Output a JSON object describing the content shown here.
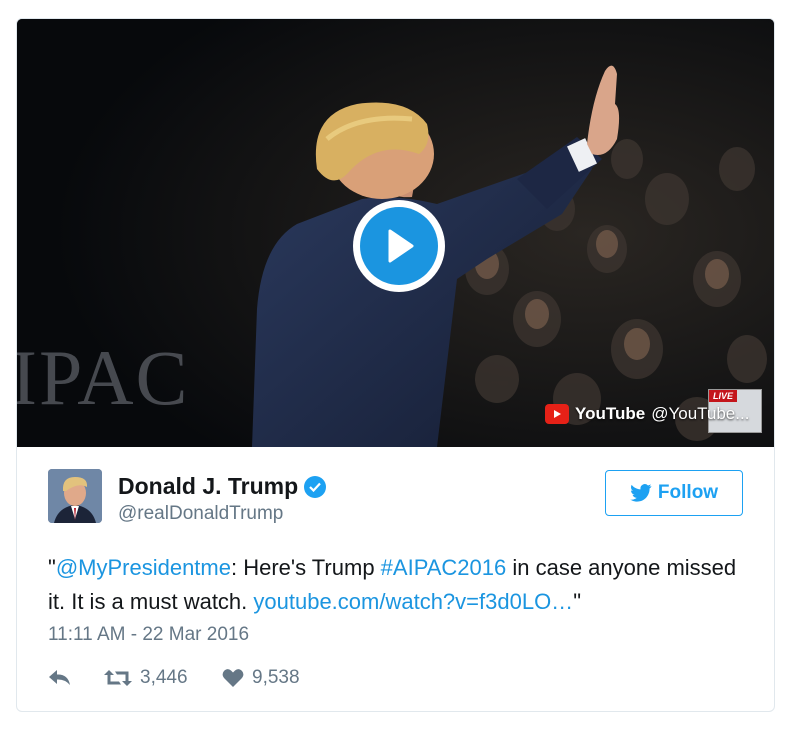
{
  "media": {
    "background_text": "IPAC",
    "youtube": {
      "label": "YouTube",
      "handle": "@YouTube..."
    },
    "live_thumb": {
      "tag": "LIVE"
    }
  },
  "author": {
    "name": "Donald J. Trump",
    "handle": "@realDonaldTrump"
  },
  "follow": {
    "label": "Follow"
  },
  "tweet": {
    "quote_open": "\"",
    "mention": "@MyPresidentme",
    "text_1": ": Here's Trump ",
    "hashtag": "#AIPAC2016",
    "text_2": " in case anyone missed it. It is a must watch. ",
    "link": "youtube.com/watch?v=f3d0LO…",
    "quote_close": "\""
  },
  "timestamp": "11:11 AM - 22 Mar 2016",
  "actions": {
    "retweets": "3,446",
    "likes": "9,538"
  },
  "colors": {
    "accent": "#1da1f2",
    "link": "#1b95e0",
    "muted": "#657786",
    "youtube_red": "#e62117"
  }
}
